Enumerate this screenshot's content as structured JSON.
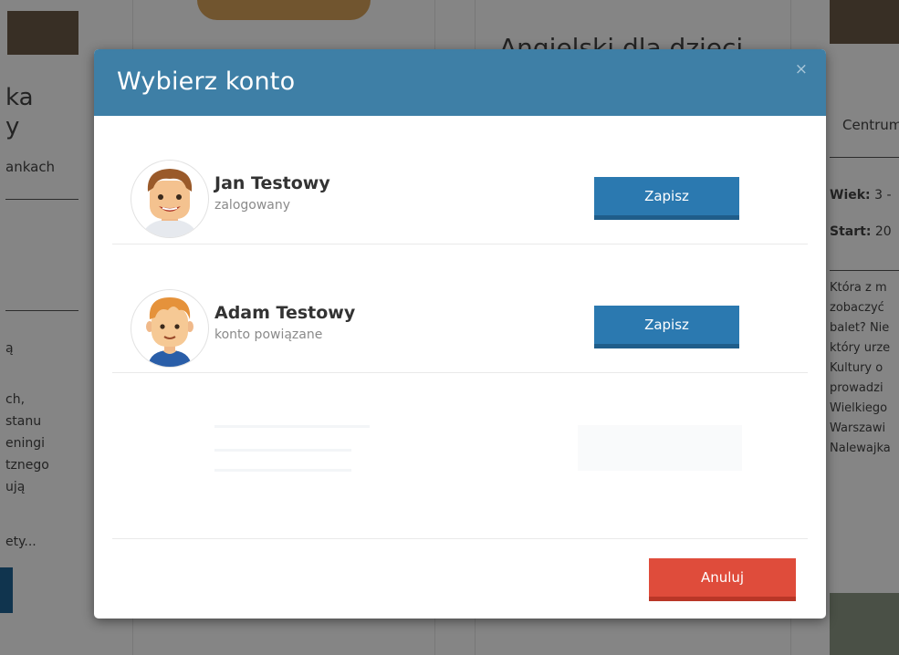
{
  "background": {
    "left_col": [
      "ka",
      "y",
      "ankach",
      "ą",
      "ch,",
      "stanu",
      "eningi",
      "tznego",
      "ują",
      "ety..."
    ],
    "mid_heading": "Angielski dla dzieci",
    "right_col": {
      "tab": "Centrum",
      "age_label": "Wiek:",
      "age_value": "3 -",
      "start_label": "Start:",
      "start_value": "20",
      "desc": [
        "Która z m",
        "zobaczyć",
        "balet? Nie",
        "który urze",
        "Kultury o",
        "prowadzi",
        "Wielkiego",
        "Warszawi",
        "Nalewajka"
      ]
    }
  },
  "modal": {
    "title": "Wybierz konto",
    "close_icon": "×",
    "accounts": [
      {
        "name": "Jan Testowy",
        "status": "zalogowany",
        "button": "Zapisz",
        "avatar": "adult-man-avatar-icon"
      },
      {
        "name": "Adam Testowy",
        "status": "konto powiązane",
        "button": "Zapisz",
        "avatar": "child-boy-avatar-icon"
      }
    ],
    "cancel": "Anuluj"
  },
  "colors": {
    "header": "#3e7fa6",
    "primary_button": "#2b79b0",
    "cancel_button": "#df4c3b"
  }
}
